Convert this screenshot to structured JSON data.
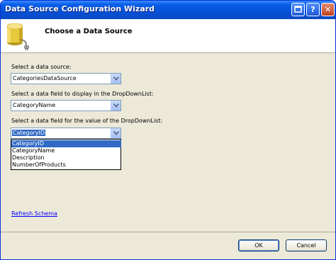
{
  "window": {
    "title": "Data Source Configuration Wizard",
    "help_glyph": "?",
    "close_glyph": "✕"
  },
  "header": {
    "title": "Choose a Data Source"
  },
  "form": {
    "source_label": "Select a data source:",
    "source_value": "CategoriesDataSource",
    "display_label": "Select a data field to display in the DropDownList:",
    "display_value": "CategoryName",
    "value_label": "Select a data field for the value of the DropDownList:",
    "value_value": "CategoryID",
    "value_options": [
      "CategoryID",
      "CategoryName",
      "Description",
      "NumberOfProducts"
    ]
  },
  "refresh_link": "Refresh Schema",
  "buttons": {
    "ok": "OK",
    "cancel": "Cancel"
  },
  "colors": {
    "titlebar": "#0651d8",
    "selection": "#316ac5",
    "dialog_bg": "#ece9d8"
  }
}
